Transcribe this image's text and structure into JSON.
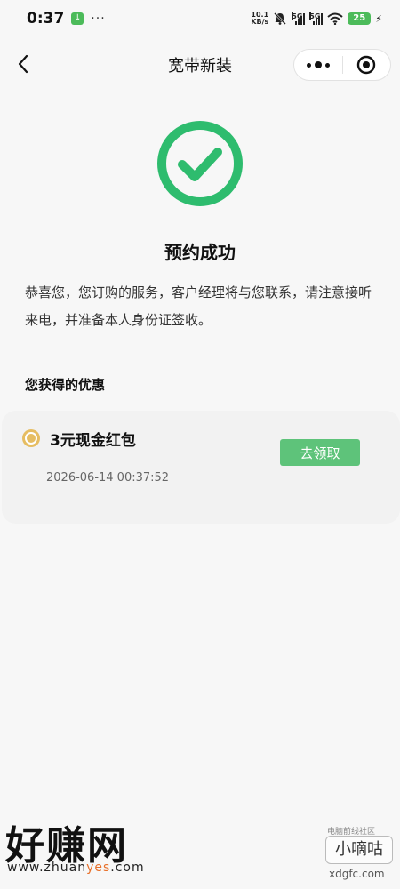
{
  "status_bar": {
    "time": "0:37",
    "download_badge": "↓",
    "more": "···",
    "net_speed_top": "10.1",
    "net_speed_bottom": "KB/s",
    "network_1": "5G",
    "network_2": "5G",
    "battery": "25",
    "icons": [
      "download-icon",
      "mute-icon",
      "signal-icon",
      "wifi-icon",
      "battery-icon",
      "charging-icon"
    ]
  },
  "nav": {
    "title": "宽带新装",
    "icons": [
      "back-arrow-icon",
      "more-icon",
      "record-icon"
    ]
  },
  "result": {
    "title": "预约成功",
    "description": "恭喜您，您订购的服务，客户经理将与您联系，请注意接听来电，并准备本人身份证签收。",
    "icon": "check-circle-icon",
    "accent_color": "#2ebc6e"
  },
  "offers": {
    "section_title": "您获得的优惠",
    "items": [
      {
        "name": "3元现金红包",
        "time": "2026-06-14 00:37:52",
        "button": "去领取",
        "icon": "coupon-icon",
        "button_color": "#5ec37a"
      }
    ]
  },
  "watermarks": {
    "left_main": "好赚网",
    "left_url_a": "www.zhuan",
    "left_url_b": "yes",
    "left_url_c": ".com",
    "right_small": "电脑前线社区",
    "right_box": "小嘀咕",
    "right_url": "xdgfc.com"
  }
}
